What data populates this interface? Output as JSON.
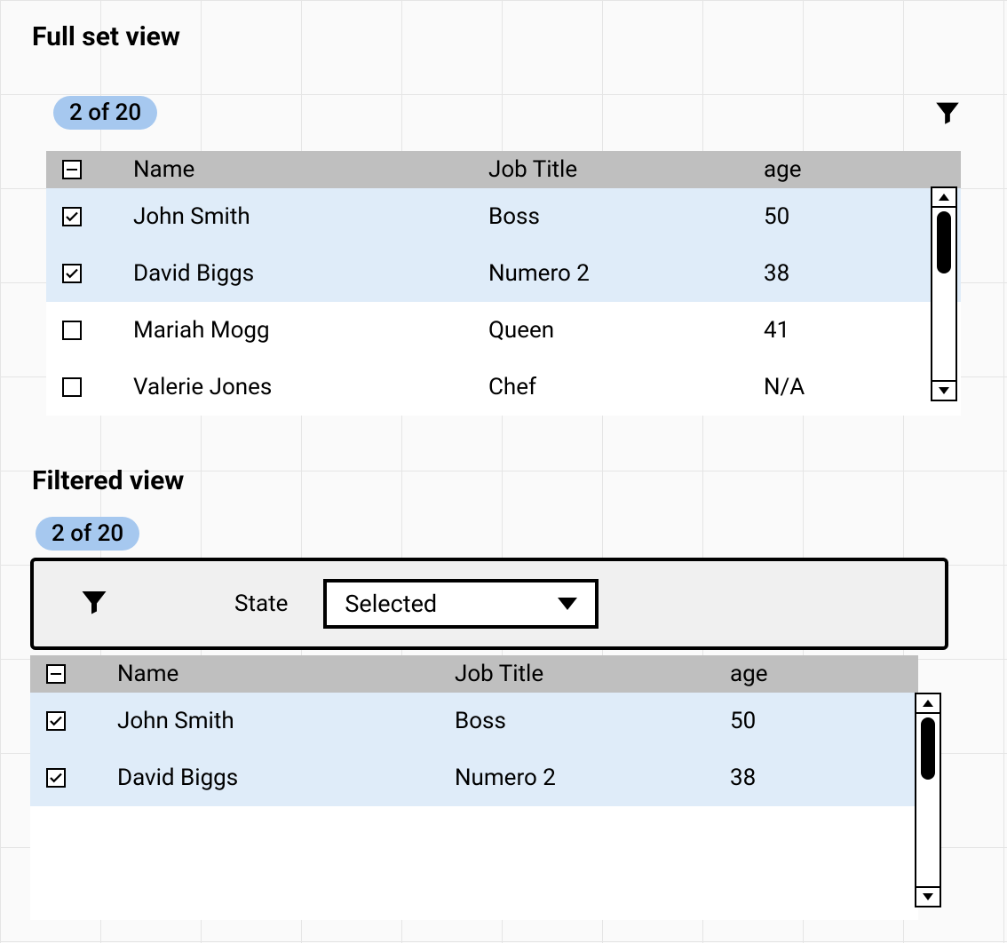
{
  "sections": {
    "full": {
      "title": "Full set view",
      "badge": "2 of 20",
      "columns": {
        "name": "Name",
        "job": "Job Title",
        "age": "age"
      },
      "rows": [
        {
          "checked": true,
          "name": "John Smith",
          "job": "Boss",
          "age": "50"
        },
        {
          "checked": true,
          "name": "David Biggs",
          "job": "Numero 2",
          "age": "38"
        },
        {
          "checked": false,
          "name": "Mariah Mogg",
          "job": "Queen",
          "age": "41"
        },
        {
          "checked": false,
          "name": "Valerie Jones",
          "job": "Chef",
          "age": "N/A"
        }
      ]
    },
    "filtered": {
      "title": "Filtered view",
      "badge": "2 of 20",
      "filter": {
        "label": "State",
        "value": "Selected"
      },
      "columns": {
        "name": "Name",
        "job": "Job Title",
        "age": "age"
      },
      "rows": [
        {
          "checked": true,
          "name": "John Smith",
          "job": "Boss",
          "age": "50"
        },
        {
          "checked": true,
          "name": "David Biggs",
          "job": "Numero 2",
          "age": "38"
        }
      ]
    }
  }
}
